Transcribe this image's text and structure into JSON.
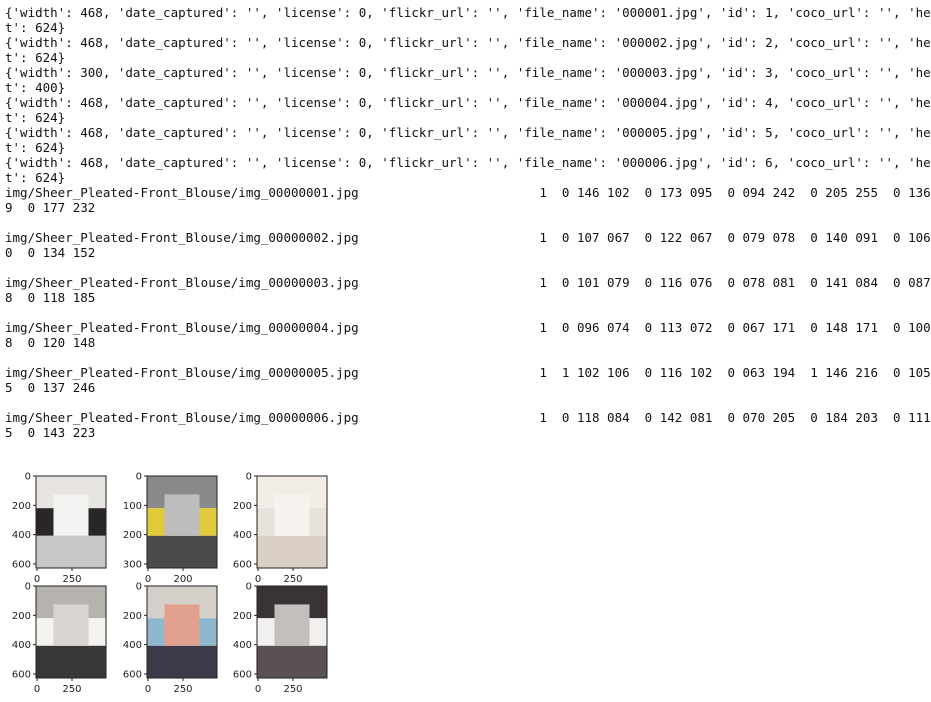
{
  "output_lines": [
    "{'width': 468, 'date_captured': '', 'license': 0, 'flickr_url': '', 'file_name': '000001.jpg', 'id': 1, 'coco_url': '', 'heigh",
    "t': 624}",
    "{'width': 468, 'date_captured': '', 'license': 0, 'flickr_url': '', 'file_name': '000002.jpg', 'id': 2, 'coco_url': '', 'heigh",
    "t': 624}",
    "{'width': 300, 'date_captured': '', 'license': 0, 'flickr_url': '', 'file_name': '000003.jpg', 'id': 3, 'coco_url': '', 'heigh",
    "t': 400}",
    "{'width': 468, 'date_captured': '', 'license': 0, 'flickr_url': '', 'file_name': '000004.jpg', 'id': 4, 'coco_url': '', 'heigh",
    "t': 624}",
    "{'width': 468, 'date_captured': '', 'license': 0, 'flickr_url': '', 'file_name': '000005.jpg', 'id': 5, 'coco_url': '', 'heigh",
    "t': 624}",
    "{'width': 468, 'date_captured': '', 'license': 0, 'flickr_url': '', 'file_name': '000006.jpg', 'id': 6, 'coco_url': '', 'heigh",
    "t': 624}",
    "img/Sheer_Pleated-Front_Blouse/img_00000001.jpg                        1  0 146 102  0 173 095  0 094 242  0 205 255  0 136 22",
    "9  0 177 232",
    "",
    "img/Sheer_Pleated-Front_Blouse/img_00000002.jpg                        1  0 107 067  0 122 067  0 079 078  0 140 091  0 106 15",
    "0  0 134 152",
    "",
    "img/Sheer_Pleated-Front_Blouse/img_00000003.jpg                        1  0 101 079  0 116 076  0 078 081  0 141 084  0 087 18",
    "8  0 118 185",
    "",
    "img/Sheer_Pleated-Front_Blouse/img_00000004.jpg                        1  0 096 074  0 113 072  0 067 171  0 148 171  0 100 14",
    "8  0 120 148",
    "",
    "img/Sheer_Pleated-Front_Blouse/img_00000005.jpg                        1  1 102 106  0 116 102  0 063 194  1 146 216  0 105 24",
    "5  0 137 246",
    "",
    "img/Sheer_Pleated-Front_Blouse/img_00000006.jpg                        1  0 118 084  0 142 081  0 070 205  0 184 203  0 111 22",
    "5  0 143 223"
  ],
  "figure_panels": [
    {
      "yticks": [
        "0",
        "200",
        "400",
        "600"
      ],
      "xticks": [
        "0",
        "250"
      ],
      "thumb_colors": [
        "#e8e4e2",
        "#2b2626",
        "#c9c6c8",
        "#f2f2f0"
      ]
    },
    {
      "yticks": [
        "0",
        "100",
        "200",
        "300"
      ],
      "xticks": [
        "0",
        "200"
      ],
      "thumb_colors": [
        "#8a8a8c",
        "#e0c93a",
        "#4b4a4c",
        "#bdbdbd"
      ]
    },
    {
      "yticks": [
        "0",
        "200",
        "400",
        "600"
      ],
      "xticks": [
        "0",
        "250"
      ],
      "thumb_colors": [
        "#f1ece6",
        "#e7e2dc",
        "#d9cfc4",
        "#f6f3ef"
      ]
    },
    {
      "yticks": [
        "0",
        "200",
        "400",
        "600"
      ],
      "xticks": [
        "0",
        "250"
      ],
      "thumb_colors": [
        "#b6b2ad",
        "#f3f2ee",
        "#3a3836",
        "#d8d4cf"
      ]
    },
    {
      "yticks": [
        "0",
        "200",
        "400",
        "600"
      ],
      "xticks": [
        "0",
        "250"
      ],
      "thumb_colors": [
        "#d4cfc8",
        "#8fb7cc",
        "#3c3a48",
        "#e2a08f"
      ]
    },
    {
      "yticks": [
        "0",
        "200",
        "400",
        "600"
      ],
      "xticks": [
        "0",
        "250"
      ],
      "thumb_colors": [
        "#3a3336",
        "#f1f0ee",
        "#5a5152",
        "#c4bfbc"
      ]
    }
  ]
}
